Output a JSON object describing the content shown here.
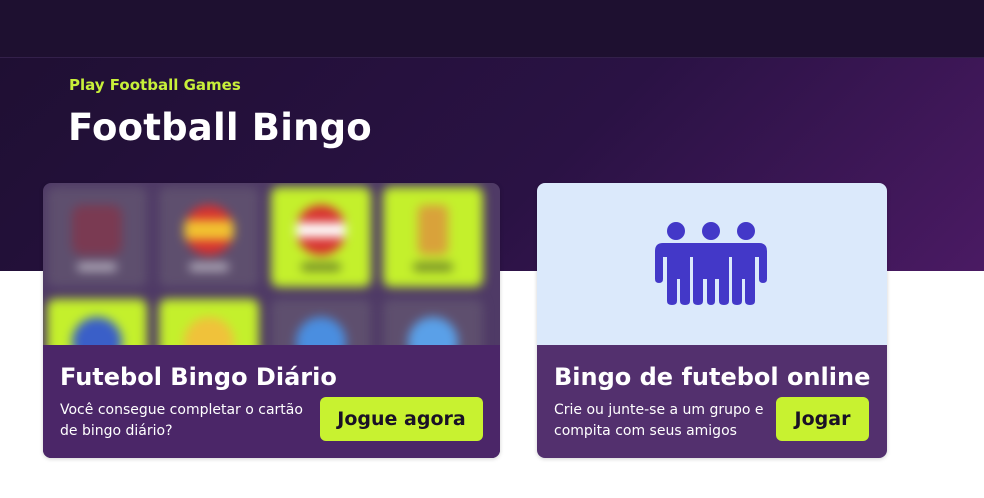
{
  "header": {
    "eyebrow": "Play Football Games",
    "title": "Football Bingo"
  },
  "cards": [
    {
      "title": "Futebol Bingo Diário",
      "description": "Você consegue completar o cartão de bingo diário?",
      "cta_label": "Jogue agora"
    },
    {
      "title": "Bingo de futebol online",
      "description": "Crie ou junte-se a um grupo e compita com seus amigos",
      "cta_label": "Jogar",
      "icon": "people-group-icon"
    }
  ],
  "colors": {
    "accent": "#c8f230",
    "hero_dark": "#1f0f33",
    "card_footer": "#4b2668",
    "icon_blue": "#4338c8",
    "card_light": "#dbe9fb"
  }
}
